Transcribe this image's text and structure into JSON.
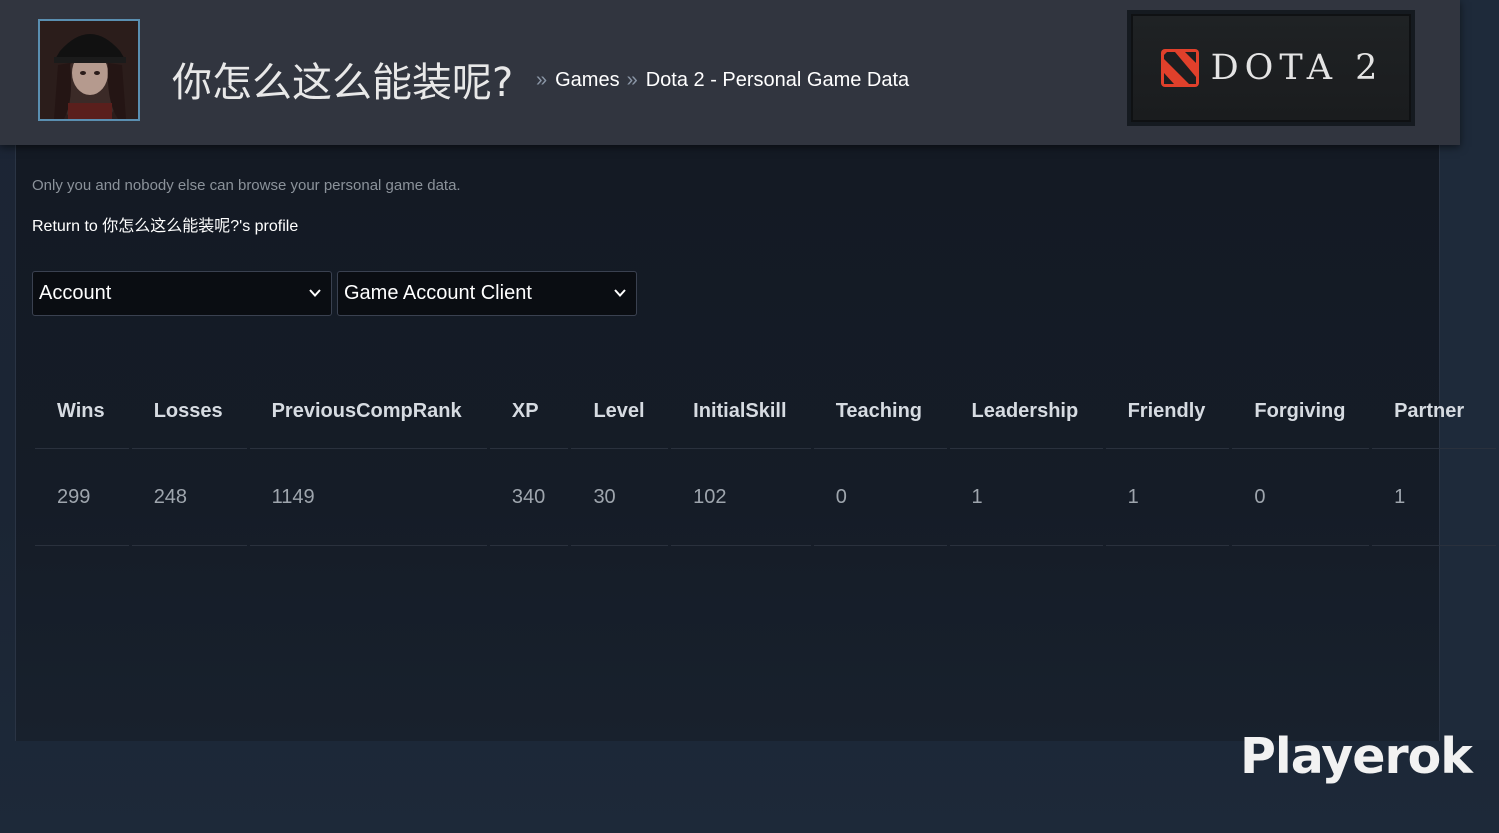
{
  "header": {
    "profile_name": "你怎么这么能装呢?",
    "breadcrumb": {
      "sep": "»",
      "games": "Games",
      "current": "Dota 2 - Personal Game Data"
    },
    "game_logo_text": "DOTA 2"
  },
  "notice": "Only you and nobody else can browse your personal game data.",
  "return_link": "Return to 你怎么这么能装呢?'s profile",
  "filters": {
    "category": "Account",
    "table": "Game Account Client"
  },
  "table": {
    "headers": [
      "Wins",
      "Losses",
      "PreviousCompRank",
      "XP",
      "Level",
      "InitialSkill",
      "Teaching",
      "Leadership",
      "Friendly",
      "Forgiving",
      "Partner"
    ],
    "rows": [
      [
        "299",
        "248",
        "1149",
        "340",
        "30",
        "102",
        "0",
        "1",
        "1",
        "0",
        "1"
      ]
    ]
  },
  "watermark": "Playerok",
  "colors": {
    "header_bg": "#31353f",
    "page_bg": "#1b2433",
    "panel_bg": "#151c27",
    "avatar_border": "#5a8fb1",
    "logo_red": "#e0402b"
  }
}
